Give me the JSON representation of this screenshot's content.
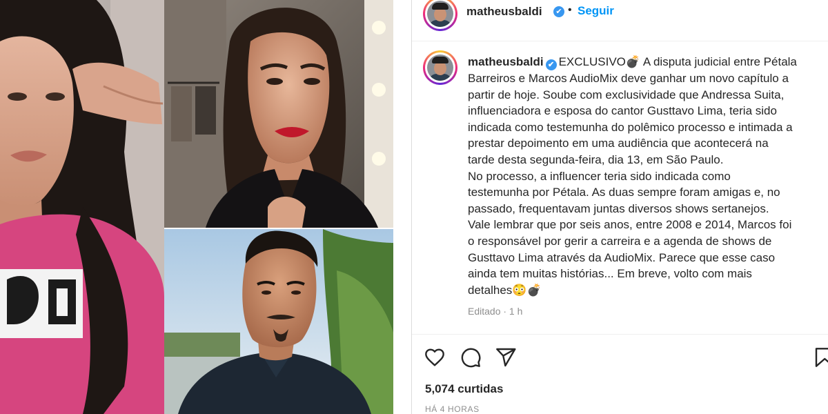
{
  "header": {
    "username": "matheusbaldi",
    "verified_mark": "✔",
    "separator": "•",
    "follow_label": "Seguir"
  },
  "caption": {
    "username": "matheusbaldi",
    "lines": [
      "EXCLUSIVO💣 A disputa judicial entre Pétala",
      "Barreiros e Marcos AudioMix deve ganhar um novo capítulo a",
      "partir de hoje. Soube com exclusividade que Andressa Suita,",
      "influenciadora e esposa do cantor Gusttavo Lima, teria sido",
      "indicada como testemunha do polêmico processo e intimada a",
      "prestar depoimento em uma audiência que acontecerá na",
      "tarde desta segunda-feira, dia 13, em São Paulo.",
      "No processo, a influencer teria sido indicada como",
      "testemunha por Pétala. As duas sempre foram amigas e, no",
      "passado, frequentavam juntas diversos shows sertanejos.",
      "Vale lembrar que por seis anos, entre 2008 e 2014, Marcos foi",
      "o responsável por gerir a carreira e a agenda de shows de",
      "Gusttavo Lima através da AudioMix. Parece que esse caso",
      "ainda tem muitas histórias... Em breve, volto com mais",
      "detalhes😳💣"
    ],
    "meta": "Editado · 1 h"
  },
  "actions": {
    "icons": [
      "heart-icon",
      "comment-icon",
      "share-icon",
      "bookmark-icon"
    ]
  },
  "likes": "5,074 curtidas",
  "time_ago": "HÁ 4 HORAS",
  "colors": {
    "accent": "#0095f6",
    "verified": "#3897f0",
    "text": "#262626",
    "muted": "#8e8e8e",
    "sweater": "#d6457f"
  }
}
